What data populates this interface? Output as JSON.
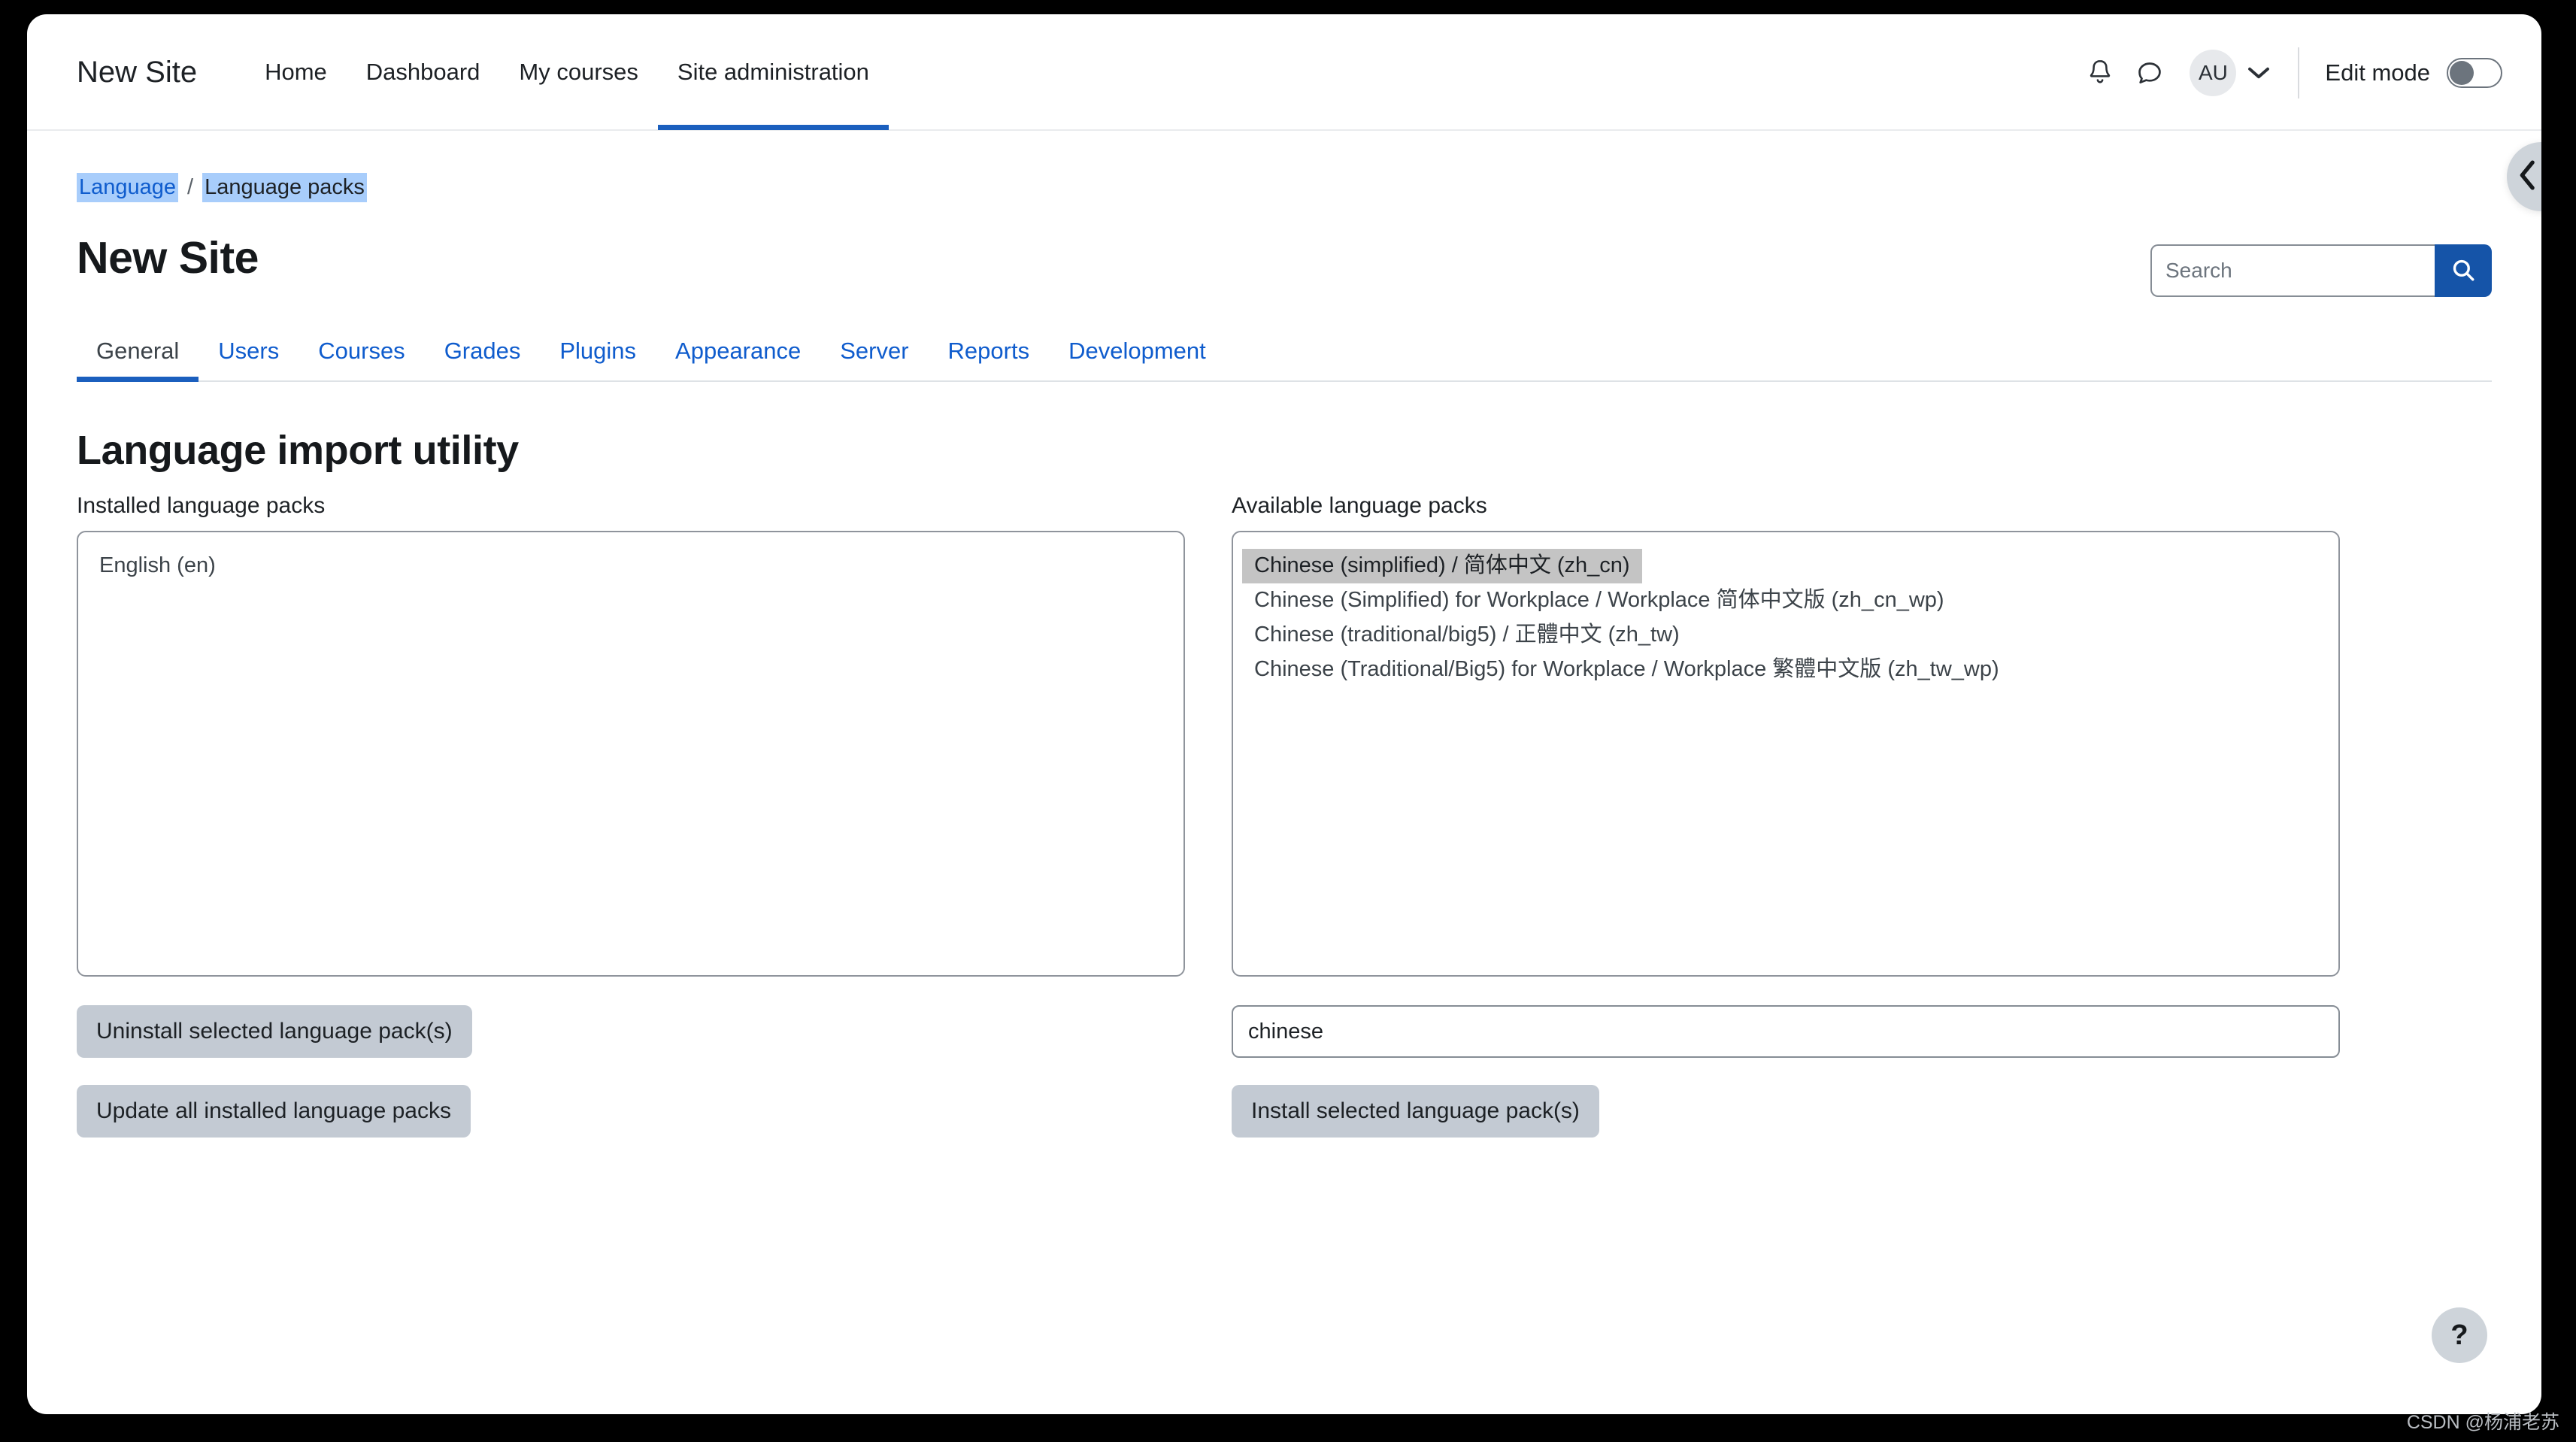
{
  "navbar": {
    "brand": "New Site",
    "links": [
      {
        "label": "Home",
        "active": false
      },
      {
        "label": "Dashboard",
        "active": false
      },
      {
        "label": "My courses",
        "active": false
      },
      {
        "label": "Site administration",
        "active": true
      }
    ],
    "notifications_icon": "bell-icon",
    "messages_icon": "message-icon",
    "avatar_initials": "AU",
    "user_menu_icon": "chevron-down-icon",
    "edit_mode_label": "Edit mode",
    "edit_mode_on": false
  },
  "breadcrumb": {
    "parent": "Language",
    "separator": "/",
    "current": "Language packs"
  },
  "header": {
    "site_title": "New Site"
  },
  "search": {
    "value": "",
    "placeholder": "Search",
    "button_icon": "search-icon"
  },
  "tabs": [
    {
      "label": "General",
      "active": true
    },
    {
      "label": "Users",
      "active": false
    },
    {
      "label": "Courses",
      "active": false
    },
    {
      "label": "Grades",
      "active": false
    },
    {
      "label": "Plugins",
      "active": false
    },
    {
      "label": "Appearance",
      "active": false
    },
    {
      "label": "Server",
      "active": false
    },
    {
      "label": "Reports",
      "active": false
    },
    {
      "label": "Development",
      "active": false
    }
  ],
  "main": {
    "heading": "Language import utility",
    "installed": {
      "label": "Installed language packs",
      "options": [
        {
          "text": "English (en)",
          "selected": false
        }
      ],
      "uninstall_button": "Uninstall selected language pack(s)",
      "update_button": "Update all installed language packs"
    },
    "available": {
      "label": "Available language packs",
      "options": [
        {
          "text": "Chinese (simplified) / 简体中文 (zh_cn)",
          "selected": true
        },
        {
          "text": "Chinese (Simplified) for Workplace / Workplace 简体中文版 (zh_cn_wp)",
          "selected": false
        },
        {
          "text": "Chinese (traditional/big5) / 正體中文 (zh_tw)",
          "selected": false
        },
        {
          "text": "Chinese (Traditional/Big5) for Workplace / Workplace 繁體中文版 (zh_tw_wp)",
          "selected": false
        }
      ],
      "filter_value": "chinese",
      "filter_placeholder": "",
      "install_button": "Install selected language pack(s)"
    }
  },
  "drawer_toggle_icon": "chevron-left-icon",
  "help_button_label": "?",
  "watermark": "CSDN @杨浦老苏",
  "colors": {
    "accent_blue": "#1b5fbe",
    "link_blue": "#0f5ccd",
    "search_button_blue": "#1554a8",
    "button_gray": "#c3cad3",
    "selection_highlight": "#a8cdfb",
    "option_selected": "#c4c4c4"
  }
}
